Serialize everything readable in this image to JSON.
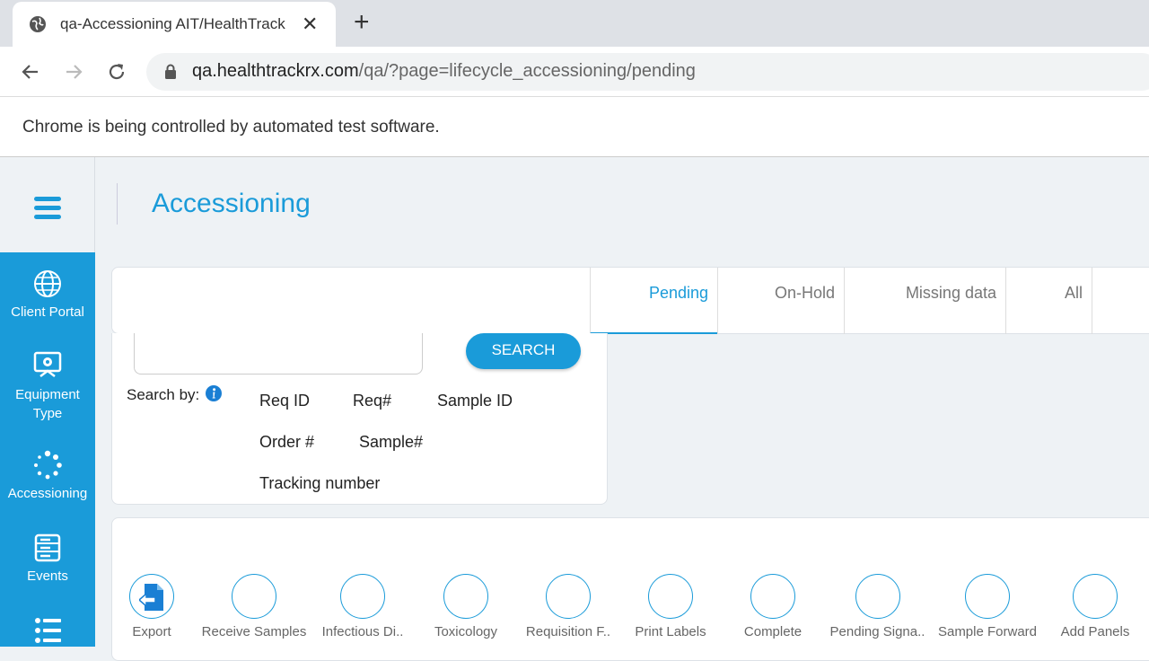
{
  "browser": {
    "tab_title": "qa-Accessioning AIT/HealthTrack",
    "url_domain": "qa.healthtrackrx.com",
    "url_path": "/qa/?page=lifecycle_accessioning/pending",
    "infobar_message": "Chrome is being controlled by automated test software."
  },
  "app": {
    "page_title": "Accessioning",
    "accent_color": "#1a9bd9"
  },
  "sidebar": {
    "items": [
      {
        "label": "Client Portal",
        "icon": "globe-network-icon"
      },
      {
        "label": "Equipment Type",
        "icon": "monitor-gear-icon"
      },
      {
        "label": "Accessioning",
        "icon": "spinner-icon"
      },
      {
        "label": "Events",
        "icon": "server-list-icon"
      },
      {
        "label": "",
        "icon": "list-icon"
      }
    ]
  },
  "tabs": [
    {
      "label": "Pending",
      "active": true
    },
    {
      "label": "On-Hold",
      "active": false
    },
    {
      "label": "Missing data",
      "active": false
    },
    {
      "label": "All",
      "active": false
    }
  ],
  "search": {
    "button_label": "SEARCH",
    "search_by_label": "Search by:",
    "options": [
      "Req ID",
      "Req#",
      "Sample ID",
      "Order #",
      "Sample#",
      "Tracking number"
    ]
  },
  "actions": [
    {
      "label": "Export"
    },
    {
      "label": "Receive Samples"
    },
    {
      "label": "Infectious Di.."
    },
    {
      "label": "Toxicology"
    },
    {
      "label": "Requisition F.."
    },
    {
      "label": "Print Labels"
    },
    {
      "label": "Complete"
    },
    {
      "label": "Pending Signa.."
    },
    {
      "label": "Sample Forward"
    },
    {
      "label": "Add Panels"
    }
  ]
}
